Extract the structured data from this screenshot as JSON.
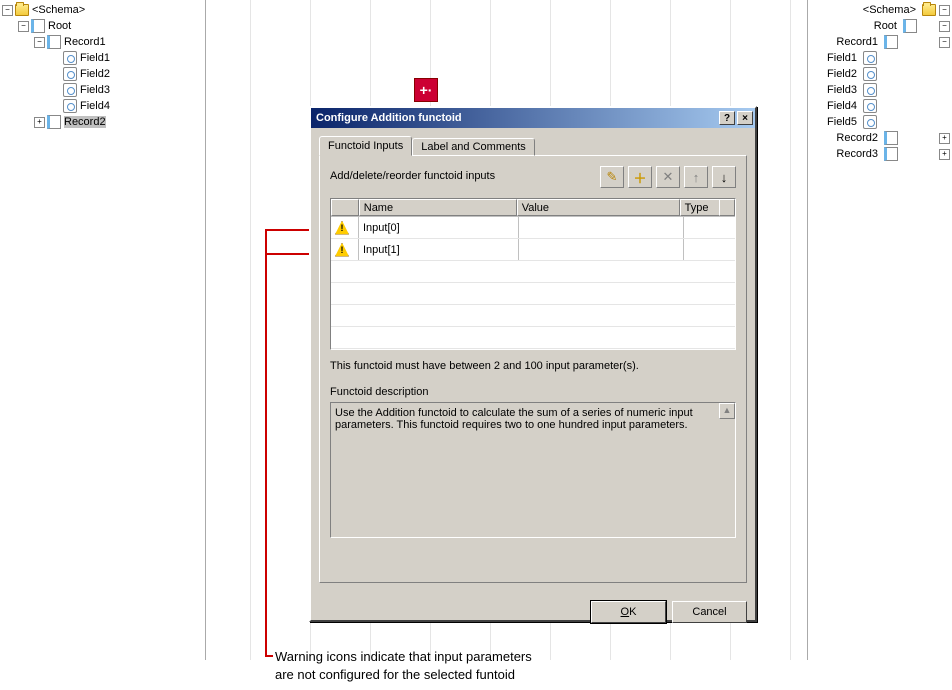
{
  "left_tree": {
    "schema": "<Schema>",
    "root": "Root",
    "record1": "Record1",
    "field1": "Field1",
    "field2": "Field2",
    "field3": "Field3",
    "field4": "Field4",
    "record2": "Record2"
  },
  "right_tree": {
    "schema": "<Schema>",
    "root": "Root",
    "record1": "Record1",
    "field1": "Field1",
    "field2": "Field2",
    "field3": "Field3",
    "field4": "Field4",
    "field5": "Field5",
    "record2": "Record2",
    "record3": "Record3"
  },
  "functoid": {
    "symbol": "+·"
  },
  "dialog": {
    "title": "Configure Addition functoid",
    "help_symbol": "?",
    "close_symbol": "×",
    "tabs": {
      "inputs": "Functoid Inputs",
      "label": "Label and Comments"
    },
    "section_label": "Add/delete/reorder functoid inputs",
    "toolbar": {
      "edit": "✎",
      "add": "＋",
      "delete": "✕",
      "up": "↑",
      "down": "↓"
    },
    "grid": {
      "headers": {
        "name": "Name",
        "value": "Value",
        "type": "Type"
      },
      "rows": [
        {
          "name": "Input[0]",
          "value": "",
          "type": ""
        },
        {
          "name": "Input[1]",
          "value": "",
          "type": ""
        }
      ]
    },
    "constraint": "This functoid must have between 2 and 100 input parameter(s).",
    "desc_label": "Functoid description",
    "desc_text": "Use the Addition functoid to calculate the sum of a series of numeric input parameters. This functoid requires two to one hundred input parameters.",
    "scroll_up": "▲",
    "ok": "OK",
    "cancel": "Cancel"
  },
  "caption": {
    "line1": "Warning icons indicate that input parameters",
    "line2": "are not configured for the selected funtoid"
  }
}
